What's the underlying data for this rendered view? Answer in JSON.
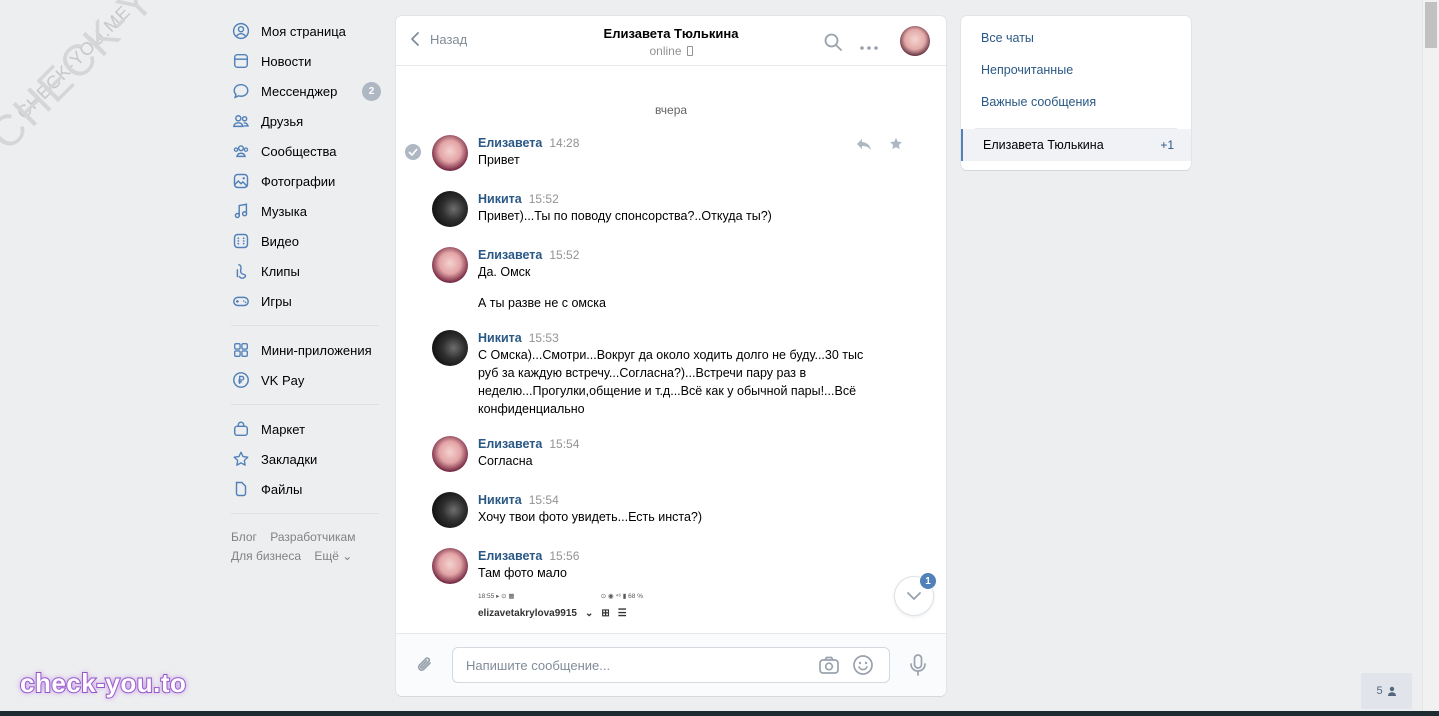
{
  "watermarks": {
    "small": "CHECK-YOU.ME",
    "big": "CHECK-YOU.ME",
    "brand": "check-you.to"
  },
  "leftnav": {
    "items": [
      {
        "label": "Моя страница",
        "icon": "user-circle-icon"
      },
      {
        "label": "Новости",
        "icon": "newspaper-icon"
      },
      {
        "label": "Мессенджер",
        "icon": "message-bubble-icon",
        "badge": "2"
      },
      {
        "label": "Друзья",
        "icon": "friends-icon"
      },
      {
        "label": "Сообщества",
        "icon": "communities-icon"
      },
      {
        "label": "Фотографии",
        "icon": "photo-icon"
      },
      {
        "label": "Музыка",
        "icon": "music-note-icon"
      },
      {
        "label": "Видео",
        "icon": "video-icon"
      },
      {
        "label": "Клипы",
        "icon": "clips-icon"
      },
      {
        "label": "Игры",
        "icon": "gamepad-icon"
      }
    ],
    "items2": [
      {
        "label": "Мини-приложения",
        "icon": "mini-apps-icon"
      },
      {
        "label": "VK Pay",
        "icon": "vk-pay-icon"
      }
    ],
    "items3": [
      {
        "label": "Маркет",
        "icon": "shopping-bag-icon"
      },
      {
        "label": "Закладки",
        "icon": "star-icon"
      },
      {
        "label": "Файлы",
        "icon": "file-icon"
      }
    ],
    "footer": {
      "blog": "Блог",
      "developers": "Разработчикам",
      "business": "Для бизнеса",
      "more": "Ещё ⌄"
    }
  },
  "chat": {
    "back_label": "Назад",
    "peer_name": "Елизавета Тюлькина",
    "peer_status": "online",
    "day_separator": "вчера",
    "messages": [
      {
        "author": "Елизавета",
        "time": "14:28",
        "texts": [
          "Привет"
        ]
      },
      {
        "author": "Никита",
        "time": "15:52",
        "texts": [
          "Привет)...Ты по поводу спонсорства?..Откуда ты?)"
        ]
      },
      {
        "author": "Елизавета",
        "time": "15:52",
        "texts": [
          "Да. Омск",
          "А ты разве не с омска"
        ]
      },
      {
        "author": "Никита",
        "time": "15:53",
        "texts": [
          "С Омска)...Смотри...Вокруг да около ходить долго не буду...30 тыс руб за каждую встречу...Согласна?)...Встречи пару раз в неделю...Прогулки,общение и т.д...Всё как у обычной пары!...Всё конфиденциально"
        ]
      },
      {
        "author": "Елизавета",
        "time": "15:54",
        "texts": [
          "Согласна"
        ]
      },
      {
        "author": "Никита",
        "time": "15:54",
        "texts": [
          "Хочу твои фото увидеть...Есть инста?)"
        ]
      },
      {
        "author": "Елизавета",
        "time": "15:56",
        "texts": [
          "Там фото мало"
        ]
      }
    ],
    "attachment_preview": {
      "status_left": "18:55 ▸ ⊙ ▦",
      "status_right": "⊙ ◉ ⁴⁶ ▮ 68 %",
      "username": "elizavetakrylova9915"
    },
    "unread_badge": "1",
    "composer_placeholder": "Напишите сообщение..."
  },
  "rightpanel": {
    "filters": [
      "Все чаты",
      "Непрочитанные",
      "Важные сообщения"
    ],
    "active_chat": "Елизавета Тюлькина",
    "active_chat_count": "+1"
  },
  "online_widget": "5",
  "colors": {
    "accent": "#5181b8",
    "link": "#2a5885",
    "background": "#edeef0"
  }
}
